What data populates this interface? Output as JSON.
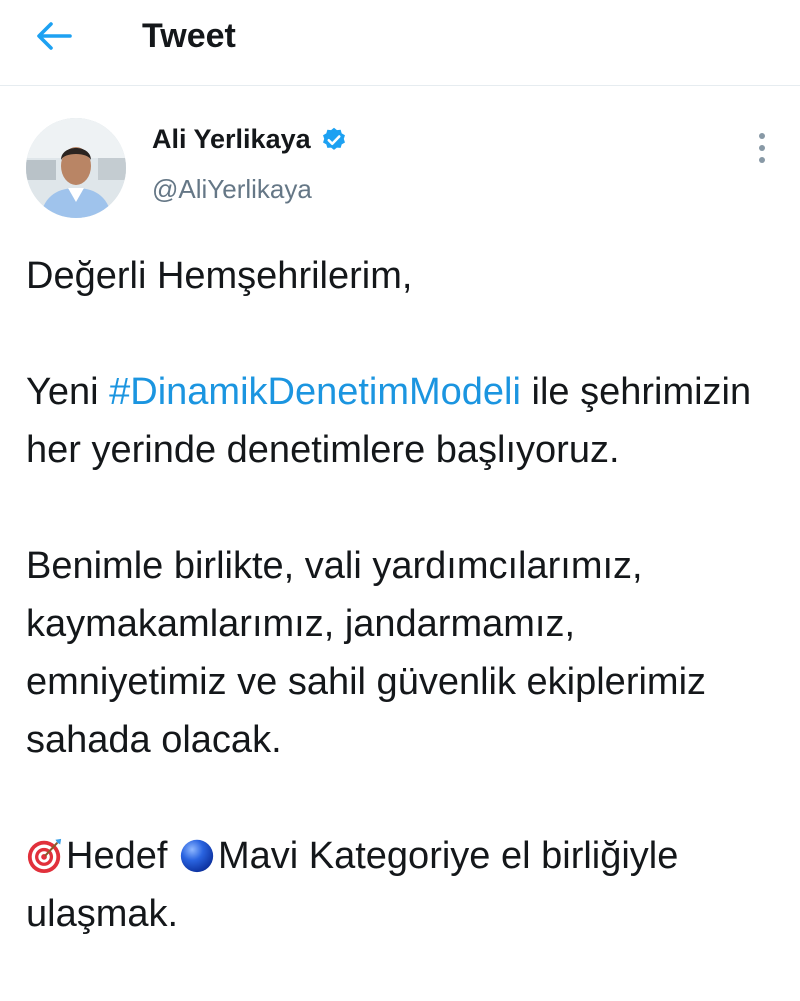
{
  "header": {
    "title": "Tweet",
    "back_icon": "arrow-left-icon",
    "accent_color": "#1da1f2"
  },
  "author": {
    "name": "Ali Yerlikaya",
    "handle": "@AliYerlikaya",
    "verified_icon": "verified-badge-icon",
    "more_icon": "more-vertical-icon"
  },
  "tweet": {
    "greeting": "Değerli Hemşehrilerim,",
    "p2_before": "Yeni ",
    "hashtag": "#DinamikDenetimModeli",
    "p2_after": " ile şehrimizin her yerinde denetimlere başlıyoruz.",
    "p3": "Benimle birlikte, vali yardımcılarımız, kaymakamlarımız, jandarmamız, emniyetimiz ve sahil güvenlik ekiplerimiz sahada olacak.",
    "p4_hedef": "Hedef ",
    "p4_rest": "Mavi Kategoriye el birliğiyle ulaşmak.",
    "emoji_1": "direct-hit-target-emoji",
    "emoji_2": "blue-circle-emoji",
    "hashtag_color": "#1b95e0"
  }
}
